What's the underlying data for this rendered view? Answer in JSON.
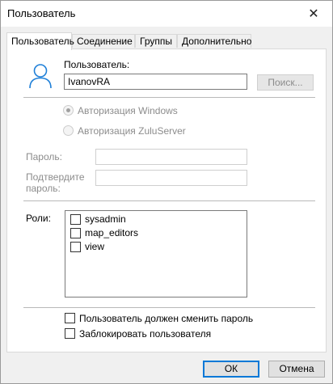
{
  "window": {
    "title": "Пользователь"
  },
  "tabs": [
    {
      "label": "Пользователь",
      "active": true
    },
    {
      "label": "Соединение",
      "active": false
    },
    {
      "label": "Группы",
      "active": false
    },
    {
      "label": "Дополнительно",
      "active": false
    }
  ],
  "user": {
    "label": "Пользователь:",
    "value": "IvanovRA",
    "search_button": "Поиск..."
  },
  "auth": {
    "windows_label": "Авторизация Windows",
    "windows_selected": true,
    "zulu_label": "Авторизация ZuluServer"
  },
  "password": {
    "label": "Пароль:",
    "confirm_label_line1": "Подтвердите",
    "confirm_label_line2": "пароль:"
  },
  "roles": {
    "label": "Роли:",
    "items": [
      {
        "name": "sysadmin",
        "checked": false
      },
      {
        "name": "map_editors",
        "checked": false
      },
      {
        "name": "view",
        "checked": false
      }
    ]
  },
  "options": {
    "must_change_password": "Пользователь должен сменить пароль",
    "lock_user": "Заблокировать пользователя"
  },
  "footer": {
    "ok": "ОК",
    "cancel": "Отмена"
  },
  "colors": {
    "accent": "#0078d7",
    "user_icon": "#1e7fd8"
  }
}
